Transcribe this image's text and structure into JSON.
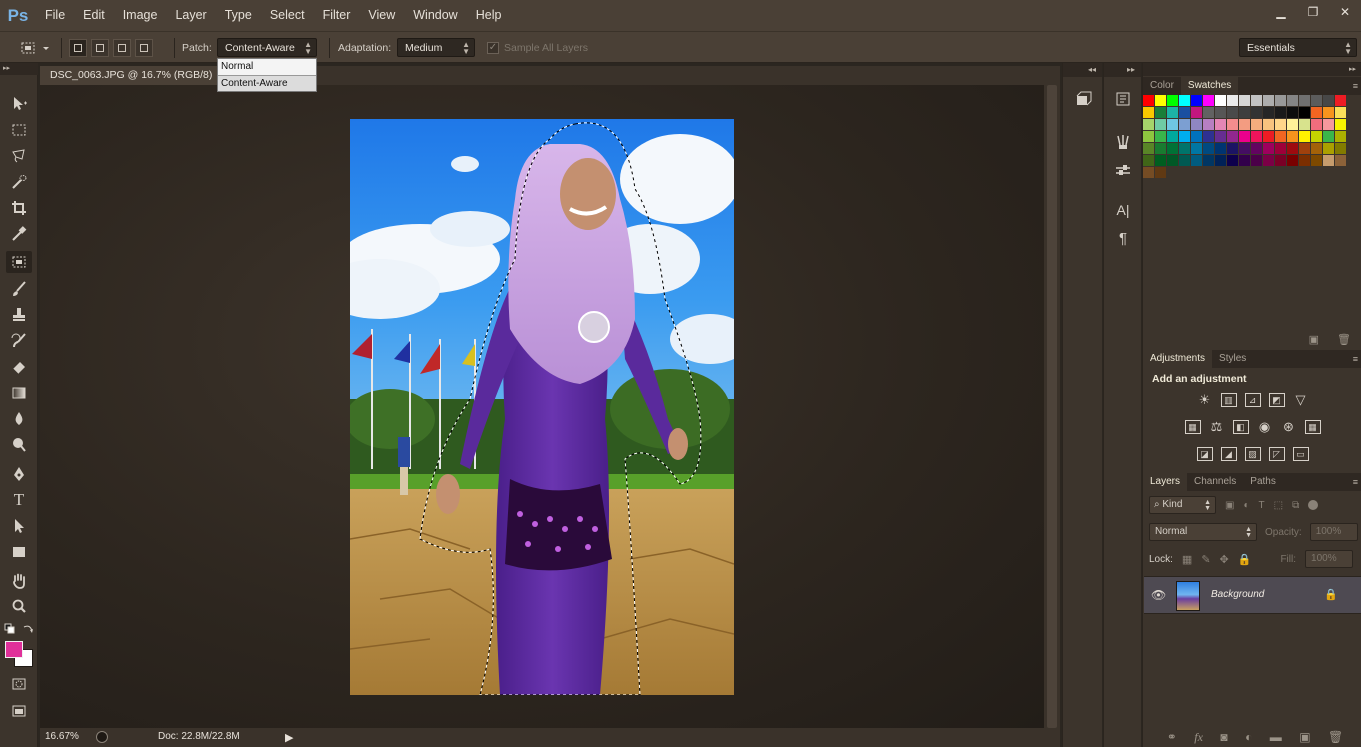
{
  "app": {
    "logo": "Ps"
  },
  "menu": [
    "File",
    "Edit",
    "Image",
    "Layer",
    "Type",
    "Select",
    "Filter",
    "View",
    "Window",
    "Help"
  ],
  "window_controls": {
    "minimize": "▁",
    "restore": "❐",
    "close": "✕"
  },
  "options": {
    "patch_label": "Patch:",
    "patch_value": "Content-Aware",
    "adaptation_label": "Adaptation:",
    "adaptation_value": "Medium",
    "sample_all_layers": "Sample All Layers",
    "workspace": "Essentials"
  },
  "patch_dropdown": {
    "options": [
      "Normal",
      "Content-Aware"
    ]
  },
  "document": {
    "tab_title": "DSC_0063.JPG @ 16.7% (RGB/8)",
    "close": "×",
    "zoom": "16.67%",
    "doc_size": "Doc: 22.8M/22.8M"
  },
  "toolbar": {
    "foreground_color": "#e0309a",
    "background_color": "#ffffff",
    "tools": [
      "move-icon",
      "marquee-icon",
      "lasso-icon",
      "quick-selection-icon",
      "crop-icon",
      "eyedropper-icon",
      "patch-tool-icon",
      "brush-icon",
      "clone-stamp-icon",
      "history-brush-icon",
      "eraser-icon",
      "gradient-icon",
      "blur-icon",
      "dodge-icon",
      "pen-icon",
      "type-icon",
      "path-selection-icon",
      "rectangle-icon",
      "hand-icon",
      "zoom-icon"
    ],
    "type_glyph": "T"
  },
  "dock": {
    "collapse": "◂◂",
    "expand": "▸▸",
    "char_icon": "A|",
    "para_icon": "¶"
  },
  "swatches_panel": {
    "tabs": [
      "Color",
      "Swatches"
    ],
    "colors": [
      "#ff0000",
      "#ffff00",
      "#00ff00",
      "#00ffff",
      "#0000ff",
      "#ff00ff",
      "#ffffff",
      "#ebebeb",
      "#d6d6d6",
      "#c2c2c2",
      "#adadad",
      "#999999",
      "#858585",
      "#707070",
      "#5c5c5c",
      "#474747",
      "#ed1c24",
      "#f9c900",
      "#1a7f3a",
      "#1db3a6",
      "#1a4fa0",
      "#c2177e",
      "#626262",
      "#565656",
      "#4a4a4a",
      "#3e3e3e",
      "#333333",
      "#262626",
      "#1a1a1a",
      "#0d0d0d",
      "#000000",
      "#f26522",
      "#f7941d",
      "#fbe05a",
      "#a5d46a",
      "#6fcba5",
      "#6fc7e3",
      "#7c9fd2",
      "#8f86c3",
      "#b77fc2",
      "#e486b5",
      "#f38d8e",
      "#f39c81",
      "#f5ad7e",
      "#f8c37f",
      "#ffd68a",
      "#fff199",
      "#d8e38d",
      "#f26d7d",
      "#f5989d",
      "#f8f400",
      "#8dc63f",
      "#39b54a",
      "#00a99d",
      "#00aeef",
      "#0072bc",
      "#2e3192",
      "#662d91",
      "#92278f",
      "#ec008c",
      "#ed145b",
      "#ed1c24",
      "#f26522",
      "#f7941d",
      "#fff200",
      "#c5d200",
      "#3ab54a",
      "#abb000",
      "#598527",
      "#197b30",
      "#007236",
      "#00746b",
      "#0076a3",
      "#004a80",
      "#003471",
      "#1b1464",
      "#440e62",
      "#630460",
      "#9e005d",
      "#9e0039",
      "#9e0b0f",
      "#a0410d",
      "#a36209",
      "#aba000",
      "#827b00",
      "#406618",
      "#005e20",
      "#005826",
      "#005952",
      "#005b7f",
      "#003663",
      "#002157",
      "#0d004c",
      "#32004b",
      "#4b0049",
      "#7b0046",
      "#7a0026",
      "#790000",
      "#7b2e00",
      "#7d4900",
      "#c69c6d",
      "#8c6239",
      "#754c24",
      "#603913"
    ]
  },
  "adjustments_panel": {
    "tabs": [
      "Adjustments",
      "Styles"
    ],
    "heading": "Add an adjustment",
    "row1": [
      "☀",
      "▥",
      "⊿",
      "◩",
      "▽"
    ],
    "row2": [
      "▦",
      "⚖",
      "◧",
      "◉",
      "⊛",
      "▦"
    ],
    "row3": [
      "◪",
      "◢",
      "▨",
      "◸",
      "▭"
    ]
  },
  "layers_panel": {
    "tabs": [
      "Layers",
      "Channels",
      "Paths"
    ],
    "kind_label": "Kind",
    "blend_mode": "Normal",
    "opacity_label": "Opacity:",
    "opacity_value": "100%",
    "lock_label": "Lock:",
    "fill_label": "Fill:",
    "fill_value": "100%",
    "layer_name": "Background",
    "footer_icons": [
      "link-icon",
      "fx-icon",
      "mask-icon",
      "adjustment-layer-icon",
      "group-icon",
      "new-layer-icon",
      "trash-icon"
    ]
  }
}
